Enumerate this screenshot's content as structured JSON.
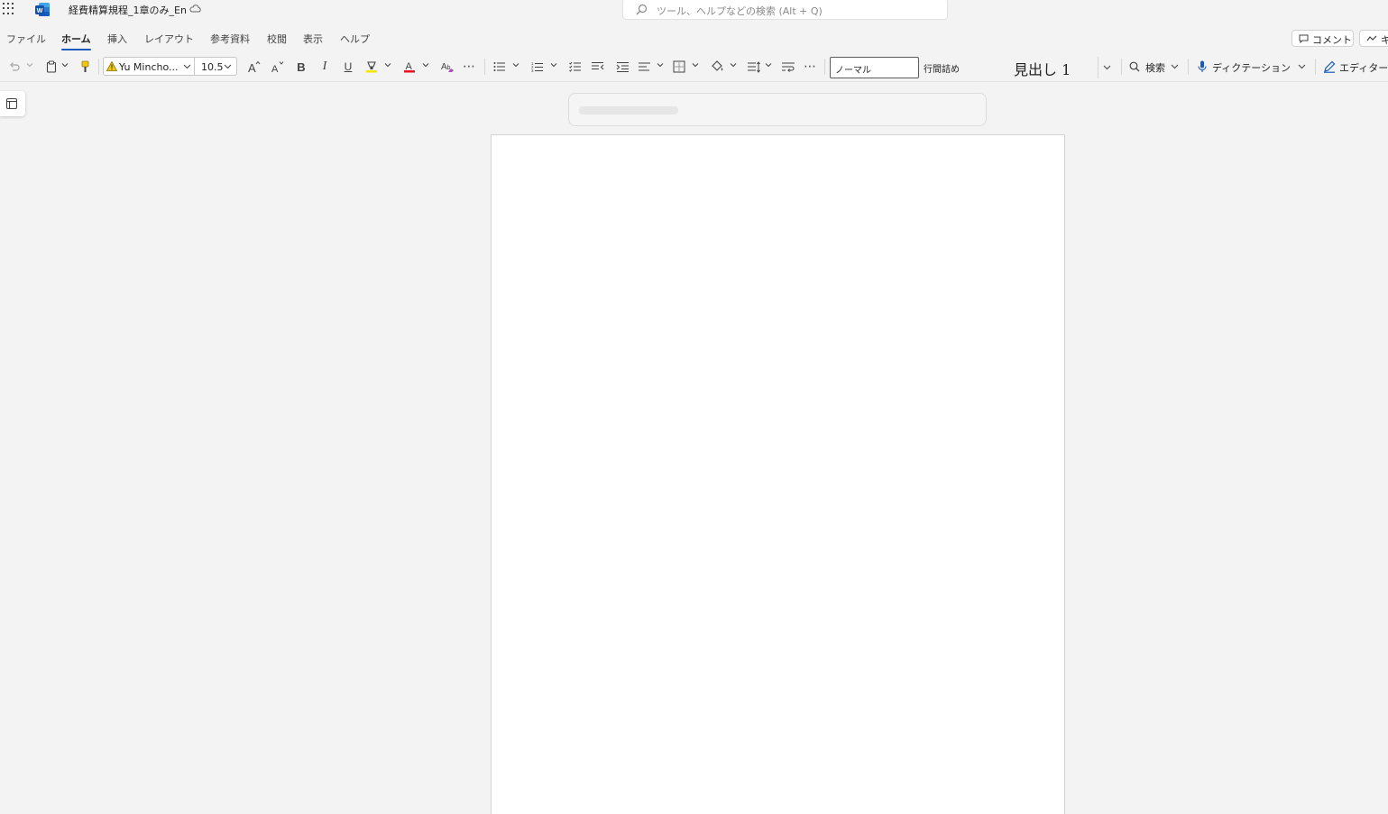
{
  "titlebar": {
    "doc_title": "経費精算規程_1章のみ_En",
    "search_placeholder": "ツール、ヘルプなどの検索 (Alt + Q)",
    "icons": [
      "app-launcher-icon",
      "word-logo-icon",
      "cloud-saved-icon",
      "search-icon"
    ]
  },
  "tabs": {
    "items": [
      {
        "label": "ファイル",
        "active": false
      },
      {
        "label": "ホーム",
        "active": true
      },
      {
        "label": "挿入",
        "active": false
      },
      {
        "label": "レイアウト",
        "active": false
      },
      {
        "label": "参考資料",
        "active": false
      },
      {
        "label": "校閲",
        "active": false
      },
      {
        "label": "表示",
        "active": false
      },
      {
        "label": "ヘルプ",
        "active": false
      }
    ],
    "comment_label": "コメント",
    "catchup_label": "キ"
  },
  "ribbon": {
    "font_name": "Yu Mincho...",
    "font_size": "10.5",
    "bold_glyph": "B",
    "italic_glyph": "I",
    "underline_glyph": "U",
    "more_glyph": "⋯",
    "styles": {
      "normal": "ノーマル",
      "no_spacing": "行間詰め",
      "heading1": "見出し 1"
    },
    "find_label": "検索",
    "dictate_label": "ディクテーション",
    "editor_label": "エディター",
    "accent_color": "#185abd",
    "font_color": "#e81123"
  }
}
